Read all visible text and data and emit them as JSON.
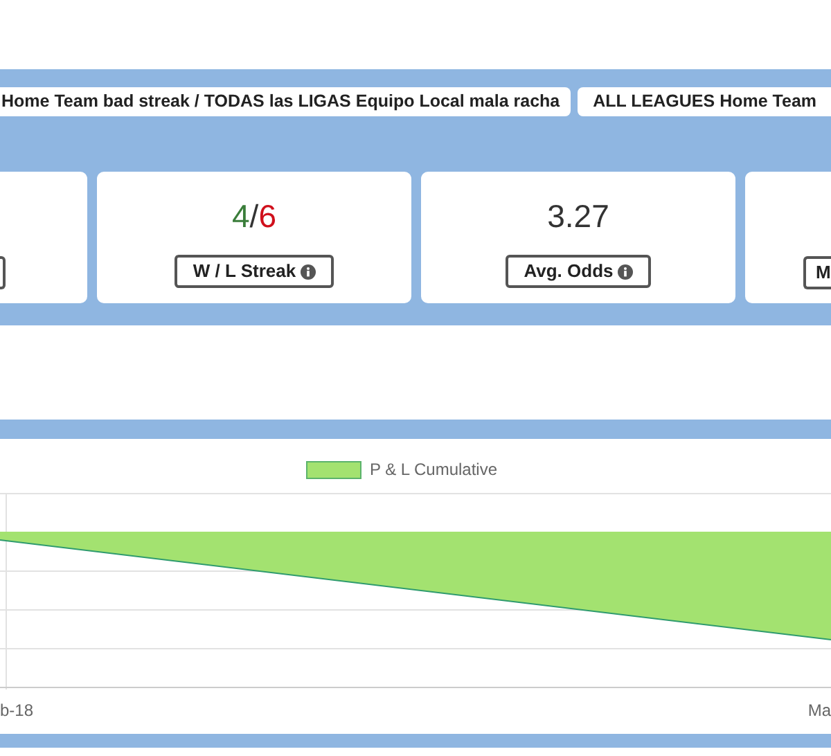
{
  "tabs": [
    {
      "label": "Home Team bad streak / TODAS las LIGAS Equipo Local mala racha"
    },
    {
      "label": "ALL LEAGUES Home Team"
    }
  ],
  "stats": [
    {
      "kind": "edge"
    },
    {
      "kind": "streak",
      "wins": "4",
      "separator": "/",
      "losses": "6",
      "label": "W / L Streak",
      "info": true
    },
    {
      "kind": "value",
      "value": "3.27",
      "label": "Avg. Odds",
      "info": true
    },
    {
      "kind": "partial",
      "label": "M"
    }
  ],
  "chart": {
    "legend": "P & L Cumulative",
    "x_labels": [
      "b-18",
      "Ma"
    ]
  }
}
